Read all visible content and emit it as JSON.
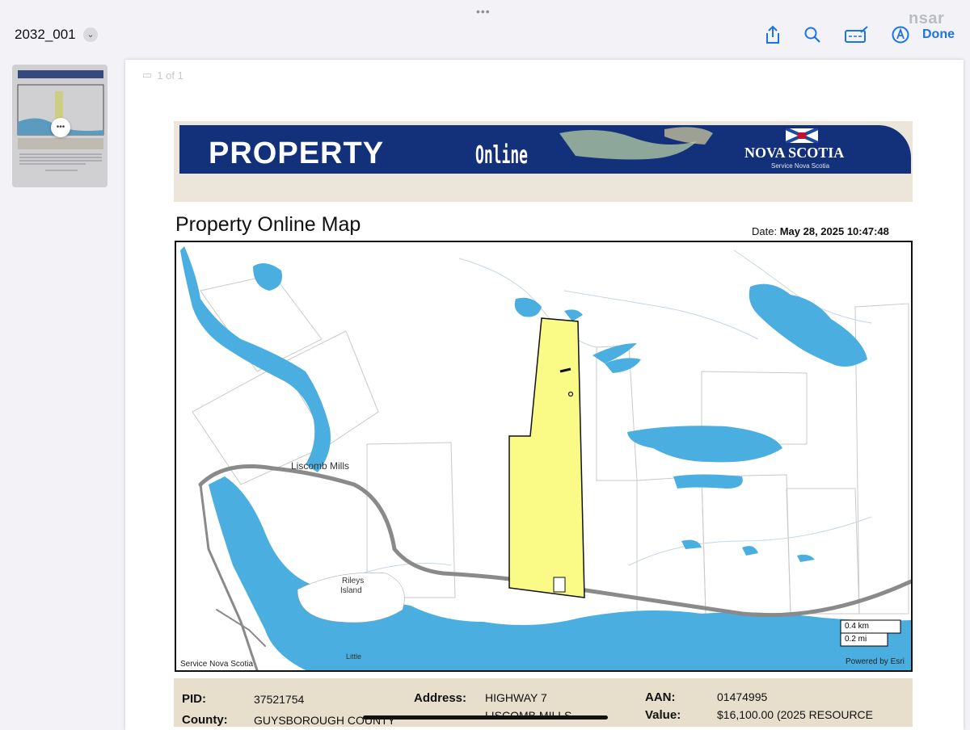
{
  "toolbar": {
    "document_title": "2032_001",
    "done_label": "Done",
    "watermark": "nsar",
    "icons": [
      "share-icon",
      "search-icon",
      "markup-icon",
      "annotate-icon"
    ]
  },
  "viewer": {
    "page_count": "1 of 1"
  },
  "document": {
    "banner": {
      "word1": "PROPERTY",
      "word2": "Online",
      "org": "NOVA SCOTIA",
      "org_sub": "Service Nova Scotia"
    },
    "map_title": "Property Online Map",
    "date_label": "Date:",
    "date_value": "May 28, 2025 10:47:48",
    "map": {
      "place_labels": [
        "Liscomb Mills",
        "Rileys",
        "Island",
        "Little"
      ],
      "scale_km": "0.4 km",
      "scale_mi": "0.2 mi",
      "credit_left": "Service Nova Scotia",
      "credit_right": "Powered by Esri",
      "colors": {
        "water": "#4aaee0",
        "parcel": "#fafa86",
        "road": "#8a8a8a"
      }
    },
    "info": {
      "pid_label": "PID:",
      "pid_value": "37521754",
      "county_label": "County:",
      "county_value": "GUYSBOROUGH COUNTY",
      "address_label": "Address:",
      "address_line1": "HIGHWAY 7",
      "address_line2": "LISCOMB MILLS",
      "aan_label": "AAN:",
      "aan_value": "01474995",
      "value_label": "Value:",
      "value_value": "$16,100.00 (2025 RESOURCE"
    }
  }
}
